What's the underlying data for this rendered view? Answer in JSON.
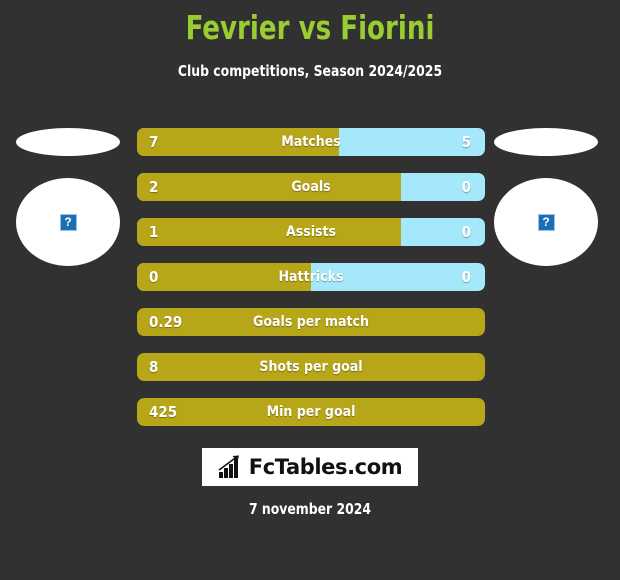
{
  "header": {
    "title": "Fevrier vs Fiorini",
    "subtitle": "Club competitions, Season 2024/2025",
    "title_color": "#9acd32"
  },
  "players": {
    "left": {
      "photo_placeholder": "broken-image",
      "placeholder_glyph": "?"
    },
    "right": {
      "photo_placeholder": "broken-image",
      "placeholder_glyph": "?"
    }
  },
  "colors": {
    "background": "#313131",
    "home_bar": "#b8a619",
    "away_bar": "#a5e8fb",
    "text": "#ffffff"
  },
  "chart_data": {
    "type": "bar",
    "title": "Fevrier vs Fiorini",
    "subtitle": "Club competitions, Season 2024/2025",
    "orientation": "horizontal-diverging",
    "series": [
      {
        "name": "Fevrier",
        "color": "#b8a619"
      },
      {
        "name": "Fiorini",
        "color": "#a5e8fb"
      }
    ],
    "categories": [
      "Matches",
      "Goals",
      "Assists",
      "Hattricks",
      "Goals per match",
      "Shots per goal",
      "Min per goal"
    ],
    "rows": [
      {
        "label": "Matches",
        "home": "7",
        "away": "5",
        "home_pct": 58,
        "two_sided": true
      },
      {
        "label": "Goals",
        "home": "2",
        "away": "0",
        "home_pct": 76,
        "two_sided": true
      },
      {
        "label": "Assists",
        "home": "1",
        "away": "0",
        "home_pct": 76,
        "two_sided": true
      },
      {
        "label": "Hattricks",
        "home": "0",
        "away": "0",
        "home_pct": 50,
        "two_sided": true
      },
      {
        "label": "Goals per match",
        "home": "0.29",
        "away": "",
        "home_pct": 100,
        "two_sided": false
      },
      {
        "label": "Shots per goal",
        "home": "8",
        "away": "",
        "home_pct": 100,
        "two_sided": false
      },
      {
        "label": "Min per goal",
        "home": "425",
        "away": "",
        "home_pct": 100,
        "two_sided": false
      }
    ]
  },
  "logo": {
    "text": "FcTables.com",
    "icon": "bar-chart-growth-icon"
  },
  "footer": {
    "date": "7 november 2024"
  }
}
